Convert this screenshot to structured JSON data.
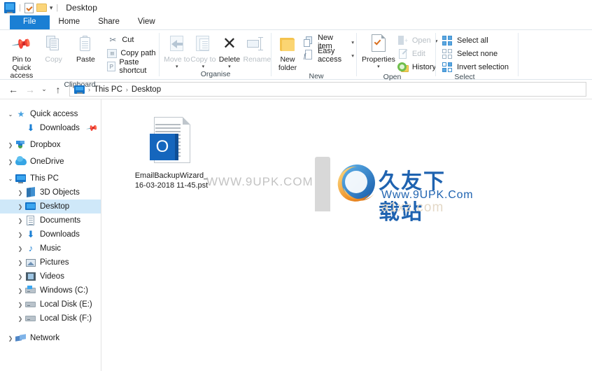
{
  "window": {
    "title": "Desktop",
    "quick_access_icons": [
      "this-pc-icon",
      "properties-icon",
      "new-folder-icon"
    ],
    "qat_caret": "▾"
  },
  "tabs": [
    {
      "label": "File",
      "name": "tab-file",
      "active": false
    },
    {
      "label": "Home",
      "name": "tab-home",
      "active": true
    },
    {
      "label": "Share",
      "name": "tab-share",
      "active": false
    },
    {
      "label": "View",
      "name": "tab-view",
      "active": false
    }
  ],
  "ribbon": {
    "groups": [
      {
        "label": "Clipboard",
        "big": [
          {
            "label": "Pin to Quick access",
            "icon": "pin-icon",
            "dim": false,
            "caret": ""
          },
          {
            "label": "Copy",
            "icon": "copy-icon",
            "dim": true,
            "caret": ""
          },
          {
            "label": "Paste",
            "icon": "paste-icon",
            "dim": false,
            "caret": ""
          }
        ],
        "small": [
          {
            "label": "Cut",
            "icon": "scissors-icon",
            "dim": false
          },
          {
            "label": "Copy path",
            "icon": "copy-path-icon",
            "dim": false
          },
          {
            "label": "Paste shortcut",
            "icon": "paste-shortcut-icon",
            "dim": false
          }
        ]
      },
      {
        "label": "Organise",
        "big": [
          {
            "label": "Move to",
            "icon": "move-to-icon",
            "dim": true,
            "caret": "▾"
          },
          {
            "label": "Copy to",
            "icon": "copy-to-icon",
            "dim": true,
            "caret": "▾"
          },
          {
            "label": "Delete",
            "icon": "delete-x-icon",
            "dim": false,
            "caret": "▾"
          },
          {
            "label": "Rename",
            "icon": "rename-icon",
            "dim": true,
            "caret": ""
          }
        ],
        "small": []
      },
      {
        "label": "New",
        "big": [
          {
            "label": "New folder",
            "icon": "new-folder-icon",
            "dim": false,
            "caret": ""
          }
        ],
        "small": [
          {
            "label": "New item",
            "icon": "new-item-icon",
            "dim": false,
            "caret": "▾"
          },
          {
            "label": "Easy access",
            "icon": "easy-access-icon",
            "dim": false,
            "caret": "▾"
          }
        ]
      },
      {
        "label": "Open",
        "big": [
          {
            "label": "Properties",
            "icon": "properties-icon",
            "dim": false,
            "caret": "▾"
          }
        ],
        "small": [
          {
            "label": "Open",
            "icon": "open-icon",
            "dim": true,
            "caret": "▾"
          },
          {
            "label": "Edit",
            "icon": "edit-icon",
            "dim": true,
            "caret": ""
          },
          {
            "label": "History",
            "icon": "history-icon",
            "dim": false,
            "caret": ""
          }
        ]
      },
      {
        "label": "Select",
        "big": [],
        "small": [
          {
            "label": "Select all",
            "icon": "select-all-icon",
            "dim": false
          },
          {
            "label": "Select none",
            "icon": "select-none-icon",
            "dim": false
          },
          {
            "label": "Invert selection",
            "icon": "invert-selection-icon",
            "dim": false
          }
        ]
      }
    ]
  },
  "address_bar": {
    "back": "←",
    "forward": "→",
    "recent": "⌄",
    "up": "↑",
    "location_icon": "this-pc-icon",
    "crumbs": [
      "This PC",
      "Desktop"
    ],
    "separator": "›"
  },
  "nav_pane": {
    "items": [
      {
        "label": "Quick access",
        "icon": "star-icon",
        "indent": 0,
        "chevron": "open",
        "selected": false,
        "pinned": false
      },
      {
        "label": "Downloads",
        "icon": "download-icon",
        "indent": 1,
        "chevron": "none",
        "selected": false,
        "pinned": true
      },
      {
        "label": "Dropbox",
        "icon": "dropbox-icon",
        "indent": 0,
        "chevron": "closed",
        "selected": false,
        "pinned": false
      },
      {
        "label": "OneDrive",
        "icon": "onedrive-icon",
        "indent": 0,
        "chevron": "closed",
        "selected": false,
        "pinned": false
      },
      {
        "label": "This PC",
        "icon": "this-pc-icon",
        "indent": 0,
        "chevron": "open",
        "selected": false,
        "pinned": false
      },
      {
        "label": "3D Objects",
        "icon": "3d-objects-icon",
        "indent": 1,
        "chevron": "closed",
        "selected": false,
        "pinned": false
      },
      {
        "label": "Desktop",
        "icon": "desktop-icon",
        "indent": 1,
        "chevron": "closed",
        "selected": true,
        "pinned": false
      },
      {
        "label": "Documents",
        "icon": "documents-icon",
        "indent": 1,
        "chevron": "closed",
        "selected": false,
        "pinned": false
      },
      {
        "label": "Downloads",
        "icon": "download-icon",
        "indent": 1,
        "chevron": "closed",
        "selected": false,
        "pinned": false
      },
      {
        "label": "Music",
        "icon": "music-icon",
        "indent": 1,
        "chevron": "closed",
        "selected": false,
        "pinned": false
      },
      {
        "label": "Pictures",
        "icon": "pictures-icon",
        "indent": 1,
        "chevron": "closed",
        "selected": false,
        "pinned": false
      },
      {
        "label": "Videos",
        "icon": "videos-icon",
        "indent": 1,
        "chevron": "closed",
        "selected": false,
        "pinned": false
      },
      {
        "label": "Windows (C:)",
        "icon": "windows-drive-icon",
        "indent": 1,
        "chevron": "closed",
        "selected": false,
        "pinned": false
      },
      {
        "label": "Local Disk (E:)",
        "icon": "drive-icon",
        "indent": 1,
        "chevron": "closed",
        "selected": false,
        "pinned": false
      },
      {
        "label": "Local Disk (F:)",
        "icon": "drive-icon",
        "indent": 1,
        "chevron": "closed",
        "selected": false,
        "pinned": false
      },
      {
        "label": "Network",
        "icon": "network-icon",
        "indent": 0,
        "chevron": "closed",
        "selected": false,
        "pinned": false
      }
    ]
  },
  "file_list": {
    "items": [
      {
        "name": "EmailBackupWizard_16-03-2018 11-45.pst",
        "icon": "outlook-pst-file-icon",
        "badge_letter": "O"
      }
    ]
  },
  "watermark": {
    "faint_url": "WWW.9UPK.COM",
    "cn_text": "久友下载站",
    "url": "Www.9UPK.Com",
    "ghost_text": "a1xz.com",
    "brand_color": "#1f63b0"
  },
  "colors": {
    "accent": "#1a7fd4",
    "selection": "#cfe8f9",
    "file_tab": "#1a7fd4",
    "pst_badge": "#1566bd"
  }
}
